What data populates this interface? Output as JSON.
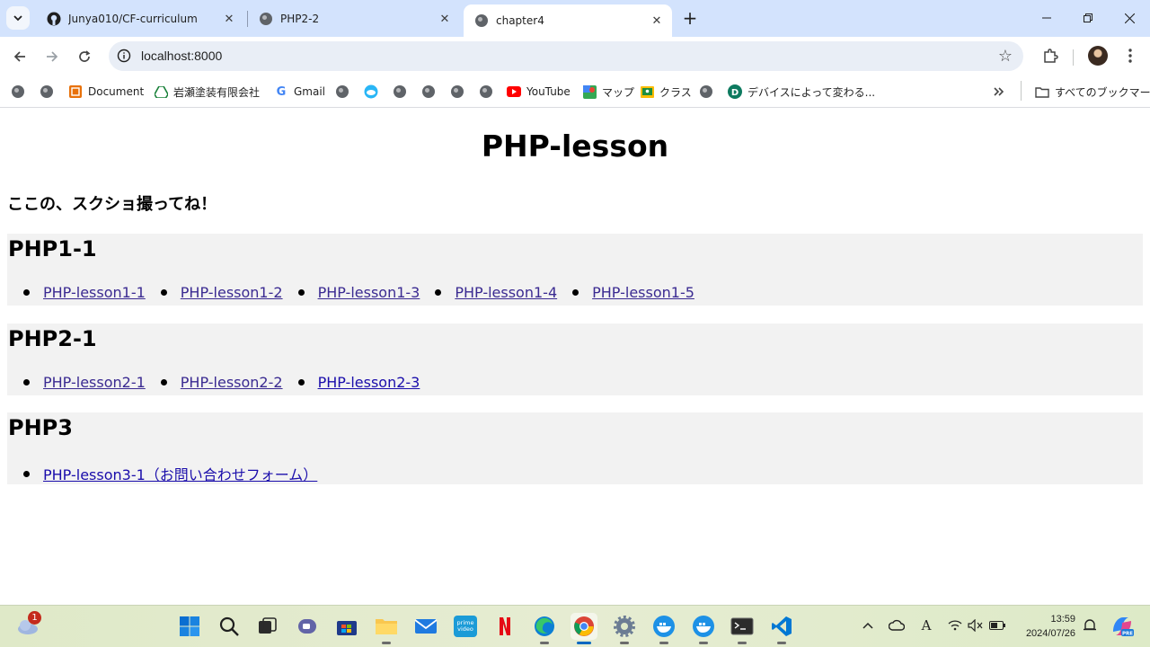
{
  "tabs": [
    {
      "title": "Junya010/CF-curriculum",
      "icon": "github-icon",
      "active": false
    },
    {
      "title": "PHP2-2",
      "icon": "globe-icon",
      "active": false
    },
    {
      "title": "chapter4",
      "icon": "globe-icon",
      "active": true
    }
  ],
  "address_bar": {
    "url": "localhost:8000"
  },
  "bookmarks": [
    {
      "label": "",
      "icon": "globe-icon"
    },
    {
      "label": "",
      "icon": "globe-icon"
    },
    {
      "label": "Document",
      "icon": "document-icon"
    },
    {
      "label": "岩瀬塗装有限会社",
      "icon": "drive-icon"
    },
    {
      "label": "Gmail",
      "icon": "google-icon"
    },
    {
      "label": "",
      "icon": "globe-icon"
    },
    {
      "label": "",
      "icon": "cloud-icon"
    },
    {
      "label": "",
      "icon": "globe-icon"
    },
    {
      "label": "",
      "icon": "globe-icon"
    },
    {
      "label": "",
      "icon": "globe-icon"
    },
    {
      "label": "",
      "icon": "globe-icon"
    },
    {
      "label": "YouTube",
      "icon": "youtube-icon"
    },
    {
      "label": "マップ",
      "icon": "maps-icon"
    },
    {
      "label": "クラス",
      "icon": "classroom-icon"
    },
    {
      "label": "",
      "icon": "globe-icon"
    },
    {
      "label": "デバイスによって変わる...",
      "icon": "d-letter-icon"
    }
  ],
  "all_bookmarks_label": "すべてのブックマーク",
  "page": {
    "heading": "PHP-lesson",
    "note": "ここの、スクショ撮ってね！",
    "sections": [
      {
        "title": "PHP1-1",
        "links": [
          "PHP-lesson1-1",
          "PHP-lesson1-2",
          "PHP-lesson1-3",
          "PHP-lesson1-4",
          "PHP-lesson1-5"
        ]
      },
      {
        "title": "PHP2-1",
        "links": [
          "PHP-lesson2-1",
          "PHP-lesson2-2",
          "PHP-lesson2-3"
        ]
      },
      {
        "title": "PHP3",
        "links": [
          "PHP-lesson3-1（お問い合わせフォーム）"
        ]
      }
    ]
  },
  "taskbar": {
    "weather_badge": "1",
    "apps": [
      "start-icon",
      "search-icon",
      "task-view-icon",
      "teams-icon",
      "store-icon",
      "file-explorer-icon",
      "mail-icon",
      "prime-video-icon",
      "netflix-icon",
      "edge-icon",
      "chrome-icon",
      "settings-icon",
      "docker-icon",
      "docker-icon",
      "terminal-icon",
      "vscode-icon"
    ],
    "time": "13:59",
    "date": "2024/07/26"
  },
  "colors": {
    "tabstrip": "#d3e3fd",
    "link_visited": "#3a2a91",
    "link": "#1a0dab",
    "section_bg": "#f2f2f2"
  }
}
